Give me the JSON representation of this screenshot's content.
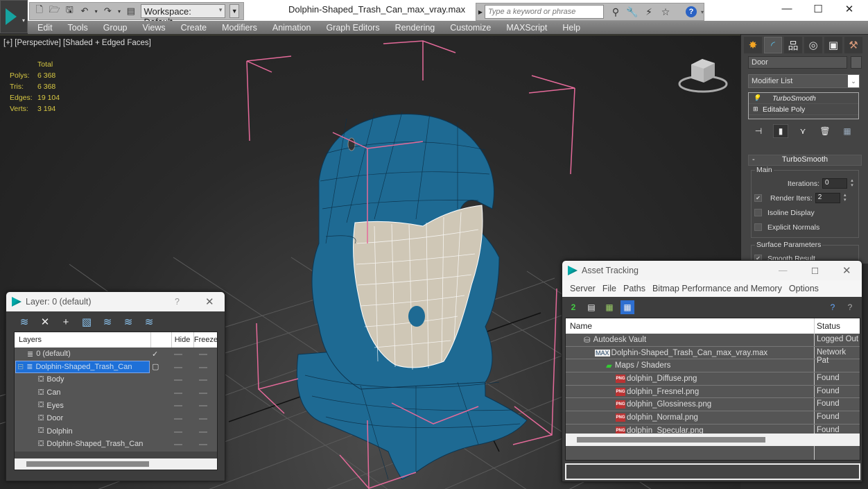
{
  "titlebar": {
    "workspace": "Workspace: Default",
    "document_title": "Dolphin-Shaped_Trash_Can_max_vray.max",
    "search_placeholder": "Type a keyword or phrase",
    "window_buttons": [
      "minimize",
      "maximize",
      "close"
    ]
  },
  "menubar": {
    "items": [
      "Edit",
      "Tools",
      "Group",
      "Views",
      "Create",
      "Modifiers",
      "Animation",
      "Graph Editors",
      "Rendering",
      "Customize",
      "MAXScript",
      "Help"
    ]
  },
  "viewport": {
    "label": "[+] [Perspective] [Shaded + Edged Faces]",
    "stats": {
      "header": "Total",
      "rows": [
        {
          "key": "Polys:",
          "value": "6 368"
        },
        {
          "key": "Tris:",
          "value": "6 368"
        },
        {
          "key": "Edges:",
          "value": "19 104"
        },
        {
          "key": "Verts:",
          "value": "3 194"
        }
      ]
    },
    "model_colors": {
      "body": "#1e6a93",
      "door": "#cfc7b6",
      "selection_box": "#e56a9a"
    }
  },
  "command_panel": {
    "object_name": "Door",
    "modifier_list": "Modifier List",
    "stack": [
      "TurboSmooth",
      "Editable Poly"
    ],
    "rollout": {
      "title": "TurboSmooth",
      "main_group": "Main",
      "iterations_label": "Iterations:",
      "iterations_value": "0",
      "render_iters_label": "Render Iters:",
      "render_iters_value": "2",
      "render_iters_checked": true,
      "isoline_display": "Isoline Display",
      "explicit_normals": "Explicit Normals",
      "surface_group": "Surface Parameters",
      "smooth_result": "Smooth Result"
    }
  },
  "layer_dialog": {
    "title": "Layer: 0 (default)",
    "help": "?",
    "columns": [
      "Layers",
      "Hide",
      "Freeze"
    ],
    "rows": [
      {
        "name": "0 (default)",
        "level": 0,
        "type": "layer",
        "current": true
      },
      {
        "name": "Dolphin-Shaped_Trash_Can",
        "level": 0,
        "type": "layer",
        "selected": true
      },
      {
        "name": "Body",
        "level": 1,
        "type": "object"
      },
      {
        "name": "Can",
        "level": 1,
        "type": "object"
      },
      {
        "name": "Eyes",
        "level": 1,
        "type": "object"
      },
      {
        "name": "Door",
        "level": 1,
        "type": "object"
      },
      {
        "name": "Dolphin",
        "level": 1,
        "type": "object"
      },
      {
        "name": "Dolphin-Shaped_Trash_Can",
        "level": 1,
        "type": "object"
      }
    ]
  },
  "asset_dialog": {
    "title": "Asset Tracking",
    "menu": [
      "Server",
      "File",
      "Paths",
      "Bitmap Performance and Memory",
      "Options"
    ],
    "columns": [
      "Name",
      "Status"
    ],
    "rows": [
      {
        "name": "Autodesk Vault",
        "status": "Logged Out",
        "level": 0,
        "icon": "vault"
      },
      {
        "name": "Dolphin-Shaped_Trash_Can_max_vray.max",
        "status": "Network Pat",
        "level": 1,
        "icon": "max-file"
      },
      {
        "name": "Maps / Shaders",
        "status": "",
        "level": 2,
        "icon": "maps"
      },
      {
        "name": "dolphin_Diffuse.png",
        "status": "Found",
        "level": 3,
        "icon": "png"
      },
      {
        "name": "dolphin_Fresnel.png",
        "status": "Found",
        "level": 3,
        "icon": "png"
      },
      {
        "name": "dolphin_Glossiness.png",
        "status": "Found",
        "level": 3,
        "icon": "png"
      },
      {
        "name": "dolphin_Normal.png",
        "status": "Found",
        "level": 3,
        "icon": "png"
      },
      {
        "name": "dolphin_Specular.png",
        "status": "Found",
        "level": 3,
        "icon": "png"
      }
    ]
  }
}
